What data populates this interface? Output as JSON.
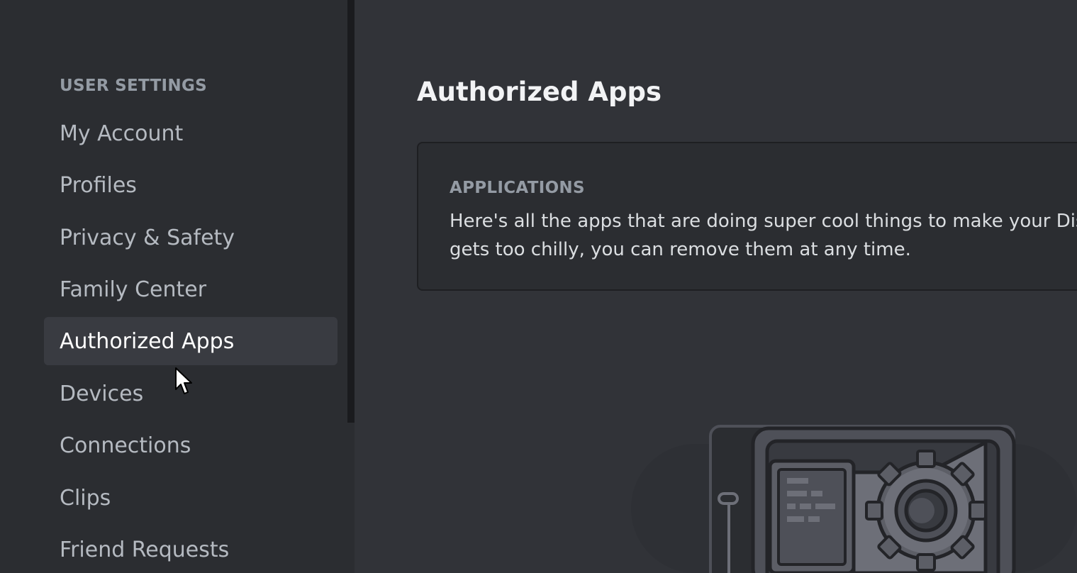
{
  "sidebar": {
    "heading": "USER SETTINGS",
    "items": [
      {
        "label": "My Account"
      },
      {
        "label": "Profiles"
      },
      {
        "label": "Privacy & Safety"
      },
      {
        "label": "Family Center"
      },
      {
        "label": "Authorized Apps",
        "active": true
      },
      {
        "label": "Devices"
      },
      {
        "label": "Connections"
      },
      {
        "label": "Clips"
      },
      {
        "label": "Friend Requests"
      }
    ]
  },
  "main": {
    "title": "Authorized Apps",
    "card": {
      "heading": "APPLICATIONS",
      "line1": "Here's all the apps that are doing super cool things to make your Disc",
      "line2": "gets too chilly, you can remove them at any time."
    }
  },
  "icons": {
    "cursor": "mouse-pointer-icon",
    "illustration": "safe-gear-illustration"
  },
  "colors": {
    "sidebar_bg": "#2b2d31",
    "main_bg": "#313338",
    "active_item_bg": "#393b41",
    "text_muted": "#949ba4",
    "text_normal": "#b5bac1",
    "text_bright": "#ffffff"
  }
}
